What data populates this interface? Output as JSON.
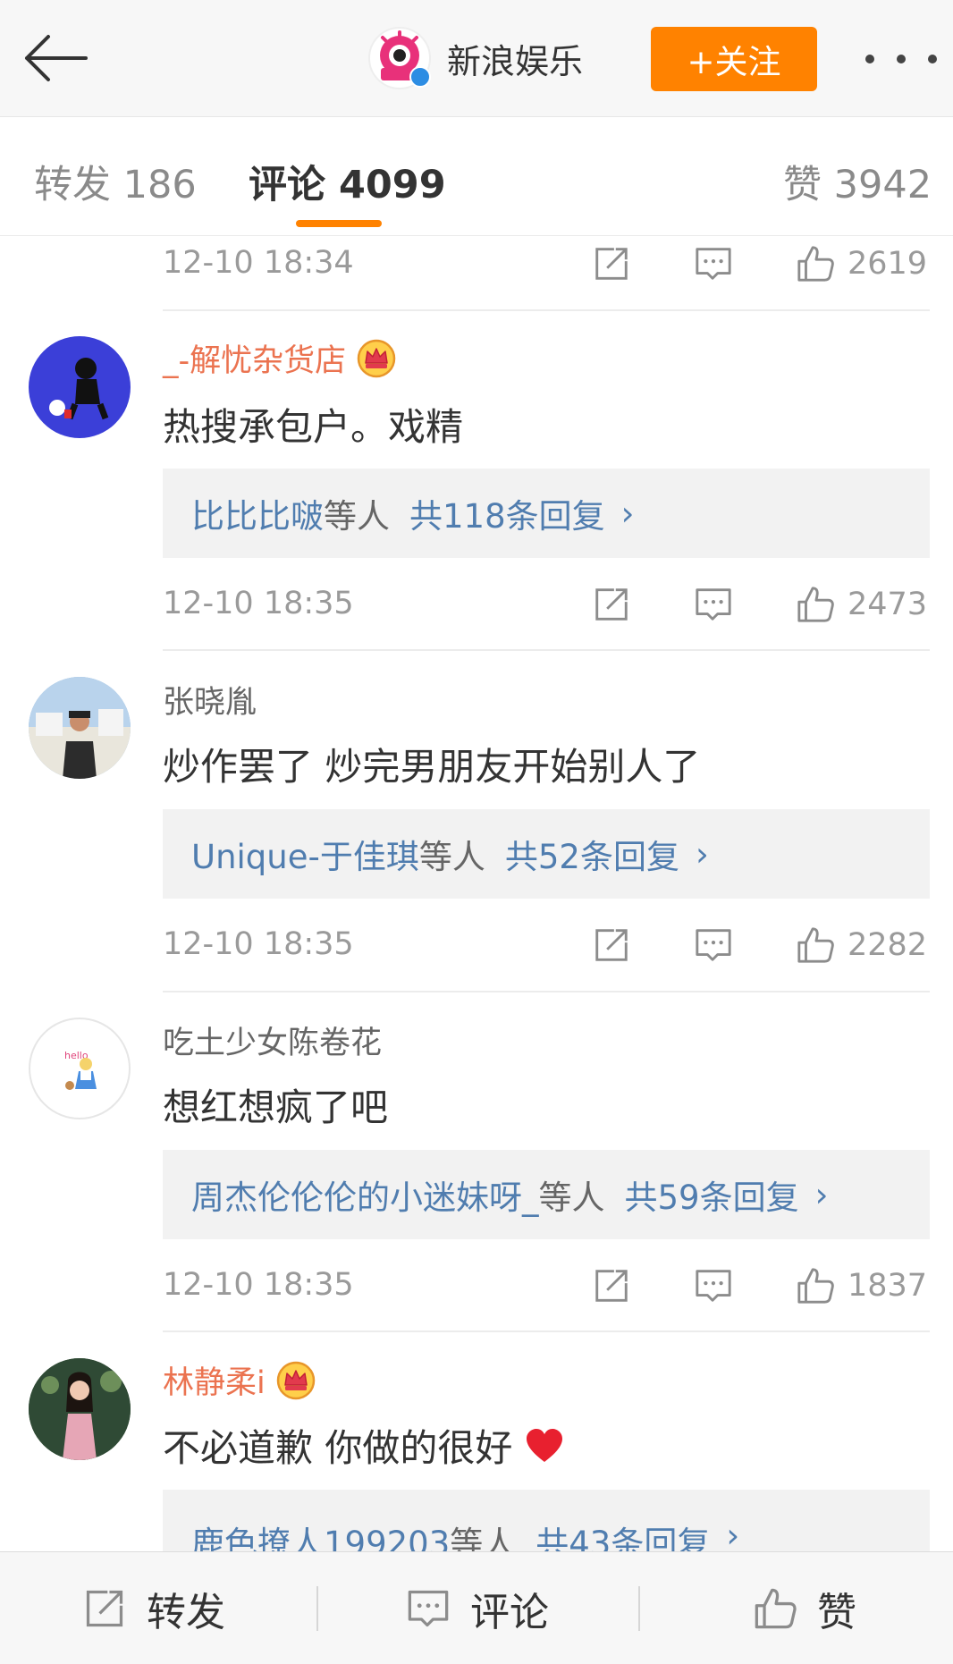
{
  "header": {
    "back_icon": "back-arrow-icon",
    "account_name": "新浪娱乐",
    "logo_text": "新浪娱乐",
    "follow_label": "+关注",
    "more_icon": "more-dots-icon"
  },
  "tabs": [
    {
      "label": "转发 186",
      "active": false
    },
    {
      "label": "评论 4099",
      "active": true
    },
    {
      "label": "赞 3942",
      "active": false
    }
  ],
  "first_meta": {
    "time": "12-10 18:34",
    "likes": "2619"
  },
  "comments": [
    {
      "username": "_-解忧杂货店",
      "vip": true,
      "text": "热搜承包户。戏精",
      "reply_names": "比比比啵",
      "reply_suffix": "等人",
      "reply_total": "共118条回复",
      "time": "12-10 18:35",
      "likes": "2473"
    },
    {
      "username": "张晓胤",
      "vip": false,
      "text": "炒作罢了 炒完男朋友开始别人了",
      "reply_names": "Unique-于佳琪",
      "reply_suffix": "等人",
      "reply_total": "共52条回复",
      "time": "12-10 18:35",
      "likes": "2282"
    },
    {
      "username": "吃土少女陈卷花",
      "vip": false,
      "text": "想红想疯了吧",
      "reply_names": "周杰伦伦伦的小迷妹呀_",
      "reply_suffix": "等人",
      "reply_total": "共59条回复",
      "time": "12-10 18:35",
      "likes": "1837"
    },
    {
      "username": "林静柔i",
      "vip": true,
      "text": "不必道歉 你做的很好",
      "reply_names": "鹿色撩人199203",
      "reply_suffix": "等人",
      "reply_total": "共43条回复",
      "time": "",
      "likes": ""
    }
  ],
  "reply_chevron": "›",
  "bottom_bar": {
    "repost_label": "转发",
    "comment_label": "评论",
    "like_label": "赞"
  },
  "colors": {
    "accent": "#ff8200",
    "vip_name": "#eb7350",
    "link": "#507daf"
  }
}
